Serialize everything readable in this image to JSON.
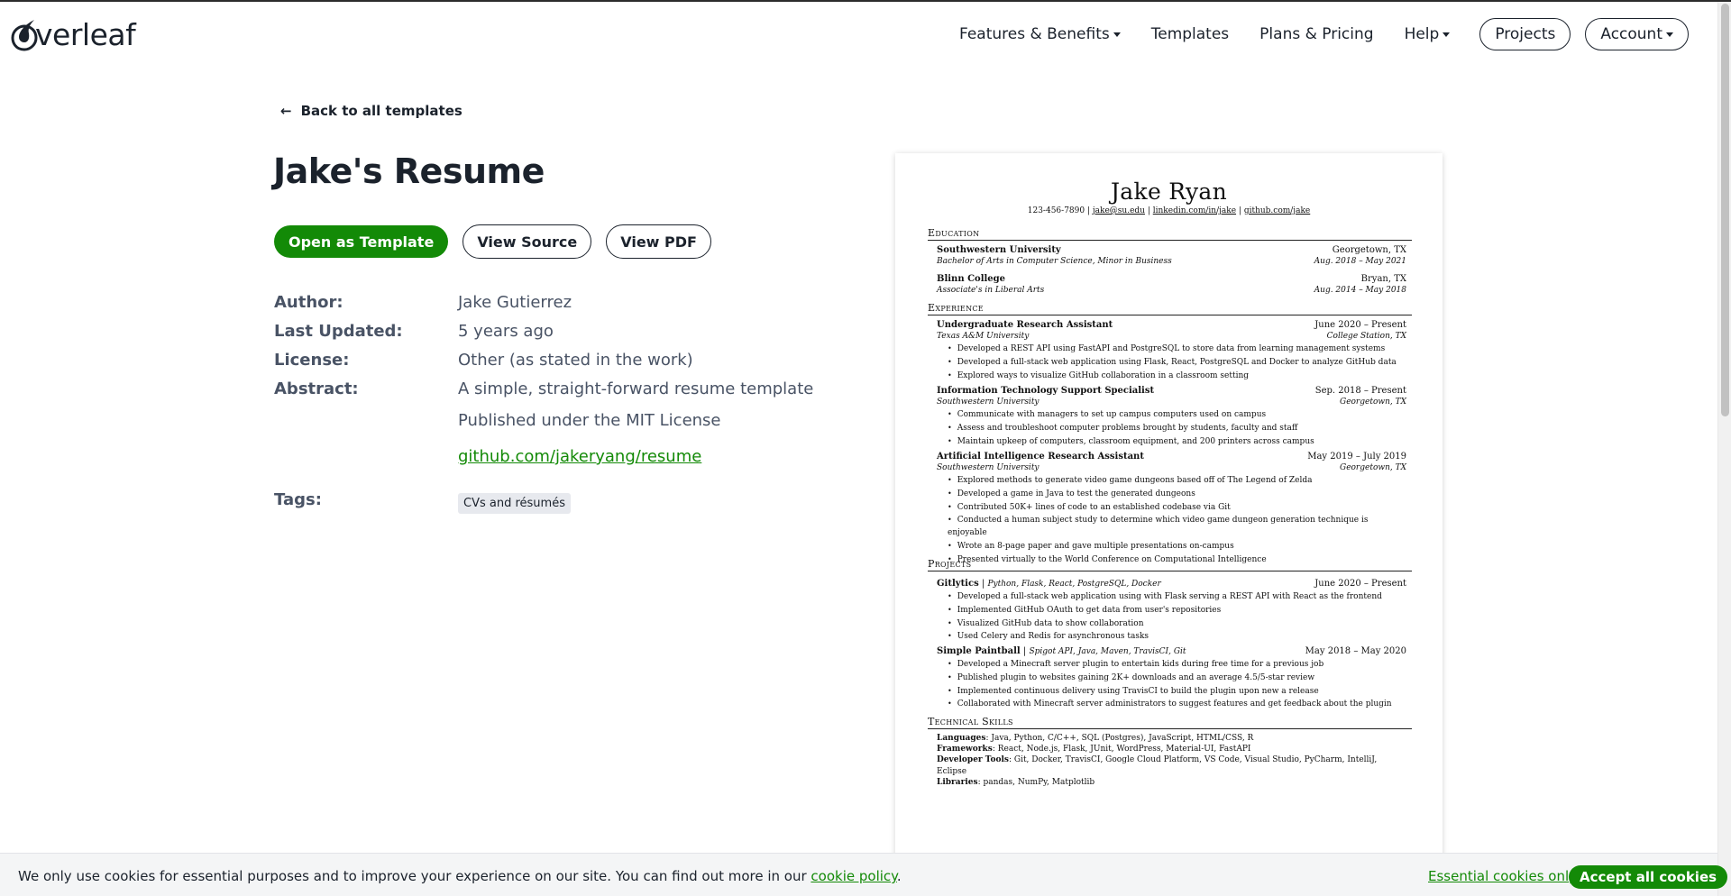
{
  "nav": {
    "logo_text": "verleaf",
    "features": "Features & Benefits",
    "templates": "Templates",
    "plans": "Plans & Pricing",
    "help": "Help",
    "projects": "Projects",
    "account": "Account"
  },
  "page": {
    "back_link": "Back to all templates",
    "title": "Jake's Resume",
    "buttons": {
      "open_template": "Open as Template",
      "view_source": "View Source",
      "view_pdf": "View PDF"
    },
    "meta": [
      {
        "label": "Author:",
        "value": "Jake Gutierrez"
      },
      {
        "label": "Last Updated:",
        "value": "5 years ago"
      },
      {
        "label": "License:",
        "value": "Other (as stated in the work)"
      },
      {
        "label": "Abstract:",
        "value": "A simple, straight-forward resume template"
      }
    ],
    "abstract_extra": "Published under the MIT License",
    "abstract_link": "github.com/jakeryang/resume",
    "tags_label": "Tags:",
    "tags": [
      "CVs and résumés"
    ]
  },
  "resume": {
    "name": "Jake Ryan",
    "contact": {
      "phone": "123-456-7890",
      "email": "jake@su.edu",
      "linkedin": "linkedin.com/in/jake",
      "github": "github.com/jake"
    },
    "sections": {
      "education": "Education",
      "experience": "Experience",
      "projects": "Projects",
      "skills": "Technical Skills"
    },
    "education": [
      {
        "school": "Southwestern University",
        "location": "Georgetown, TX",
        "degree": "Bachelor of Arts in Computer Science, Minor in Business",
        "dates": "Aug. 2018 – May 2021"
      },
      {
        "school": "Blinn College",
        "location": "Bryan, TX",
        "degree": "Associate's in Liberal Arts",
        "dates": "Aug. 2014 – May 2018"
      }
    ],
    "experience": [
      {
        "title": "Undergraduate Research Assistant",
        "dates": "June 2020 – Present",
        "org": "Texas A&M University",
        "location": "College Station, TX",
        "bullets": [
          "Developed a REST API using FastAPI and PostgreSQL to store data from learning management systems",
          "Developed a full-stack web application using Flask, React, PostgreSQL and Docker to analyze GitHub data",
          "Explored ways to visualize GitHub collaboration in a classroom setting"
        ]
      },
      {
        "title": "Information Technology Support Specialist",
        "dates": "Sep. 2018 – Present",
        "org": "Southwestern University",
        "location": "Georgetown, TX",
        "bullets": [
          "Communicate with managers to set up campus computers used on campus",
          "Assess and troubleshoot computer problems brought by students, faculty and staff",
          "Maintain upkeep of computers, classroom equipment, and 200 printers across campus"
        ]
      },
      {
        "title": "Artificial Intelligence Research Assistant",
        "dates": "May 2019 – July 2019",
        "org": "Southwestern University",
        "location": "Georgetown, TX",
        "bullets": [
          "Explored methods to generate video game dungeons based off of The Legend of Zelda",
          "Developed a game in Java to test the generated dungeons",
          "Contributed 50K+ lines of code to an established codebase via Git",
          "Conducted a human subject study to determine which video game dungeon generation technique is enjoyable",
          "Wrote an 8-page paper and gave multiple presentations on-campus",
          "Presented virtually to the World Conference on Computational Intelligence"
        ]
      }
    ],
    "projects": [
      {
        "name": "Gitlytics",
        "stack": "Python, Flask, React, PostgreSQL, Docker",
        "dates": "June 2020 – Present",
        "bullets": [
          "Developed a full-stack web application using with Flask serving a REST API with React as the frontend",
          "Implemented GitHub OAuth to get data from user's repositories",
          "Visualized GitHub data to show collaboration",
          "Used Celery and Redis for asynchronous tasks"
        ]
      },
      {
        "name": "Simple Paintball",
        "stack": "Spigot API, Java, Maven, TravisCI, Git",
        "dates": "May 2018 – May 2020",
        "bullets": [
          "Developed a Minecraft server plugin to entertain kids during free time for a previous job",
          "Published plugin to websites gaining 2K+ downloads and an average 4.5/5-star review",
          "Implemented continuous delivery using TravisCI to build the plugin upon new a release",
          "Collaborated with Minecraft server administrators to suggest features and get feedback about the plugin"
        ]
      }
    ],
    "skills": [
      {
        "label": "Languages",
        "value": "Java, Python, C/C++, SQL (Postgres), JavaScript, HTML/CSS, R"
      },
      {
        "label": "Frameworks",
        "value": "React, Node.js, Flask, JUnit, WordPress, Material-UI, FastAPI"
      },
      {
        "label": "Developer Tools",
        "value": "Git, Docker, TravisCI, Google Cloud Platform, VS Code, Visual Studio, PyCharm, IntelliJ, Eclipse"
      },
      {
        "label": "Libraries",
        "value": "pandas, NumPy, Matplotlib"
      }
    ]
  },
  "cookie": {
    "text": "We only use cookies for essential purposes and to improve your experience on our site. You can find out more in our ",
    "link": "cookie policy",
    "period": ".",
    "essential": "Essential cookies only",
    "accept": "Accept all cookies"
  },
  "colors": {
    "brand_green": "#138a07",
    "text_dark": "#1b222c",
    "text_muted": "#495365"
  }
}
